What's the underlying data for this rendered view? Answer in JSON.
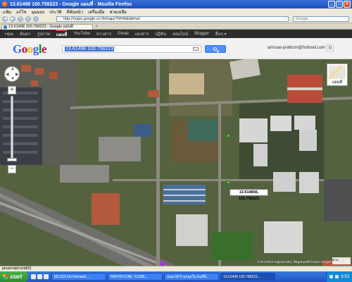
{
  "window": {
    "title": "13.61498 100.758223 - Google แผนที่ - Mozilla Firefox",
    "controls": [
      "_",
      "□",
      "×"
    ]
  },
  "menubar": [
    "แฟ้ม",
    "แก้ไข",
    "มุมมอง",
    "ประวัติ",
    "ที่คั่นหน้า",
    "เครื่องมือ",
    "ช่วยเหลือ"
  ],
  "nav": {
    "url": "http://maps.google.co.th/maps?hl=th&tab=wl",
    "search_placeholder": "Google"
  },
  "tabs": [
    {
      "label": "13.61498 100.758223 - Google แผนที่"
    }
  ],
  "google_bar": [
    "+คุณ",
    "ค้นหา",
    "รูปภาพ",
    "แผนที่",
    "YouTube",
    "ข่าวสาร",
    "Gmail",
    "เอกสาร",
    "ปฏิทิน",
    "ออนไลน์",
    "Blogger",
    "อื่นๆ ▾"
  ],
  "google_bar_active": 3,
  "header": {
    "logo_letters": [
      "G",
      "o",
      "o",
      "g",
      "l",
      "e"
    ],
    "search_value": "13.61498 100.758223",
    "email": "amnuai-prathom@hotmail.com"
  },
  "map": {
    "type_label": "แผนที่",
    "zoom_plus": "+",
    "zoom_minus": "−",
    "coordinate_label": "13.614856, 100.758223",
    "copyright": "ภาพ ©2012 DigitalGlobe, ข้อมูลแผนที่ ©2012 Google",
    "scale_label": "50 ม."
  },
  "status": {
    "text": "javascript:void(0)"
  },
  "taskbar": {
    "start": "start",
    "tasks": [
      "MCS32 On-Demand ...",
      "PANTIP.COM : K1185...",
      "หมุด GPS ทุกจุดใน พบที่นี่...",
      "13.61498 100.758223..."
    ],
    "active_index": 3,
    "clock": "9:53"
  },
  "colors": {
    "accent": "#4d90fe",
    "title_bar": "#1c4fc2",
    "taskbar": "#1f55c6",
    "start": "#2e8b2e"
  }
}
